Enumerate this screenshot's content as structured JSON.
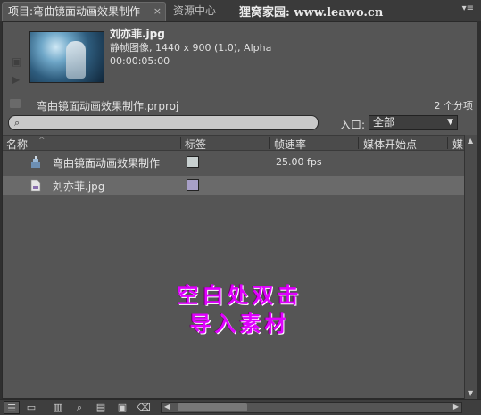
{
  "tabs": {
    "project_tab": "项目:弯曲镜面动画效果制作",
    "project_close": "×",
    "resource_tab": "资源中心",
    "watermark": "狸窝家园: www.leawo.cn",
    "menu_icon": "▾≡"
  },
  "preview": {
    "clip_name": "刘亦菲.jpg",
    "clip_info": "静帧图像, 1440 x 900 (1.0), Alpha",
    "clip_duration": "00:00:05:00"
  },
  "project": {
    "file_name": "弯曲镜面动画效果制作.prproj",
    "item_count": "2 个分项"
  },
  "search": {
    "placeholder": "",
    "entry_label": "入口:",
    "entry_value": "全部"
  },
  "columns": {
    "name": "名称",
    "label": "标签",
    "frame_rate": "帧速率",
    "media_start": "媒体开始点",
    "media_more": "媒"
  },
  "rows": [
    {
      "name": "弯曲镜面动画效果制作",
      "label_color": "#c8d0d0",
      "frame_rate": "25.00 fps",
      "icon": "sequence-icon"
    },
    {
      "name": "刘亦菲.jpg",
      "label_color": "#a8a0c8",
      "frame_rate": "",
      "icon": "image-file-icon"
    }
  ],
  "overlay": {
    "line1": "空白处双击",
    "line2": "导入素材"
  },
  "icons": {
    "list_view": "list-view-icon",
    "icon_view": "icon-view-icon",
    "automate": "automate-to-sequence-icon",
    "find": "find-icon",
    "new_bin": "new-bin-icon",
    "new_item": "new-item-icon",
    "clear": "trash-icon"
  }
}
